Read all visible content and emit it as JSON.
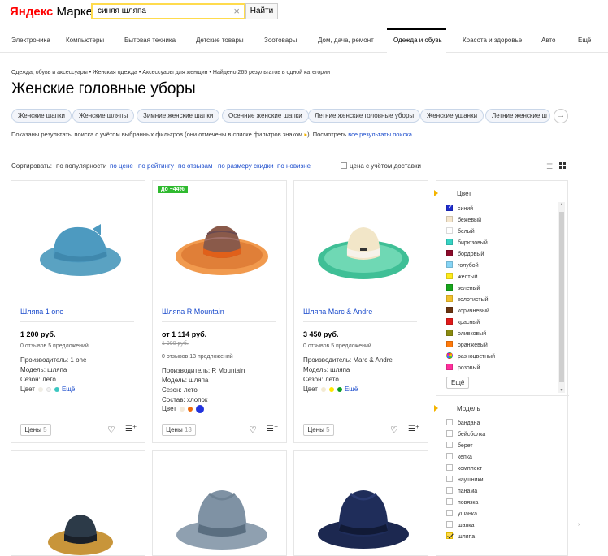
{
  "header": {
    "logo_y": "Яндекс",
    "logo_rest": " Маркет",
    "search_value": "синяя шляпа",
    "search_button": "Найти"
  },
  "nav": [
    "Электроника",
    "Компьютеры",
    "Бытовая техника",
    "Детские товары",
    "Зоотовары",
    "Дом, дача, ремонт",
    "Одежда и обувь",
    "Красота и здоровье",
    "Авто",
    "Ещё"
  ],
  "breadcrumbs": "Одежда, обувь и аксессуары • Женская одежда • Аксессуары для женщин • Найдено 265 результатов в одной категории",
  "page_title": "Женские головные уборы",
  "chips": [
    "Женские шапки",
    "Женские шляпы",
    "Зимние женские шапки",
    "Осенние женские шапки",
    "Летние женские головные уборы",
    "Женские ушанки",
    "Летние женские ш"
  ],
  "notice": {
    "text": "Показаны результаты поиска с учётом выбранных фильтров (они отмечены в списке фильтров знаком",
    "after": "). Посмотреть",
    "link": "все результаты поиска."
  },
  "sort": {
    "label": "Сортировать:",
    "items": [
      "по популярности",
      "по цене",
      "по рейтингу",
      "по отзывам",
      "по размеру скидки",
      "по новизне"
    ],
    "delivery_checkbox": "цена с учётом доставки"
  },
  "products": [
    {
      "name": "Шляпа 1 one",
      "price": "1 200 руб.",
      "old_price": "",
      "reviews": "0 отзывов    5 предложений",
      "specs": [
        "Производитель: 1 one",
        "Модель: шляпа",
        "Сезон: лето"
      ],
      "color_label": "Цвет",
      "colors": [
        "#f0ede4",
        "#f2f2f2",
        "#3cc7c1"
      ],
      "more": "Ещё",
      "prices_label": "Цены",
      "prices_count": "5"
    },
    {
      "name": "Шляпа R Mountain",
      "price": "от 1 114 руб.",
      "old_price": "1 990 руб.",
      "badge": "до −44%",
      "reviews": "0 отзывов    13 предложений",
      "specs": [
        "Производитель: R Mountain",
        "Модель: шляпа",
        "Сезон: лето",
        "Состав: хлопок"
      ],
      "color_label": "Цвет",
      "colors": [
        "#f3e9d8",
        "#ee6a0c",
        "#2233dd"
      ],
      "more": "",
      "prices_label": "Цены",
      "prices_count": "13"
    },
    {
      "name": "Шляпа Marc & Andre",
      "price": "3 450 руб.",
      "old_price": "",
      "reviews": "0 отзывов    5 предложений",
      "specs": [
        "Производитель: Marc & Andre",
        "Модель: шляпа",
        "Сезон: лето"
      ],
      "color_label": "Цвет",
      "colors": [
        "#f3ead3",
        "#ffe600",
        "#0a9c22"
      ],
      "more": "Ещё",
      "prices_label": "Цены",
      "prices_count": "5"
    }
  ],
  "filter": {
    "color_title": "Цвет",
    "colors": [
      {
        "label": "синий",
        "hex": "#1e2ccc",
        "checked": true
      },
      {
        "label": "бежевый",
        "hex": "#f5e6cc"
      },
      {
        "label": "белый",
        "hex": "#ffffff"
      },
      {
        "label": "бирюзовый",
        "hex": "#36d3c4"
      },
      {
        "label": "бордовый",
        "hex": "#8b0a2a"
      },
      {
        "label": "голубой",
        "hex": "#86d4f5"
      },
      {
        "label": "желтый",
        "hex": "#ffec1a"
      },
      {
        "label": "зеленый",
        "hex": "#17a61c"
      },
      {
        "label": "золотистый",
        "hex": "#f2c12c"
      },
      {
        "label": "коричневый",
        "hex": "#6a3310"
      },
      {
        "label": "красный",
        "hex": "#e01a1a"
      },
      {
        "label": "оливковый",
        "hex": "#8a8a10"
      },
      {
        "label": "оранжевый",
        "hex": "#ff7a0a"
      },
      {
        "label": "разноцветный",
        "hex": "multi"
      },
      {
        "label": "розовый",
        "hex": "#ff2f9c"
      }
    ],
    "colors_more": "Ещё",
    "model_title": "Модель",
    "models": [
      {
        "label": "бандана"
      },
      {
        "label": "бейсболка"
      },
      {
        "label": "берет"
      },
      {
        "label": "кепка"
      },
      {
        "label": "комплект"
      },
      {
        "label": "наушники"
      },
      {
        "label": "панама"
      },
      {
        "label": "повязка"
      },
      {
        "label": "ушанка"
      },
      {
        "label": "шапка"
      },
      {
        "label": "шляпа",
        "checked": true
      }
    ]
  }
}
